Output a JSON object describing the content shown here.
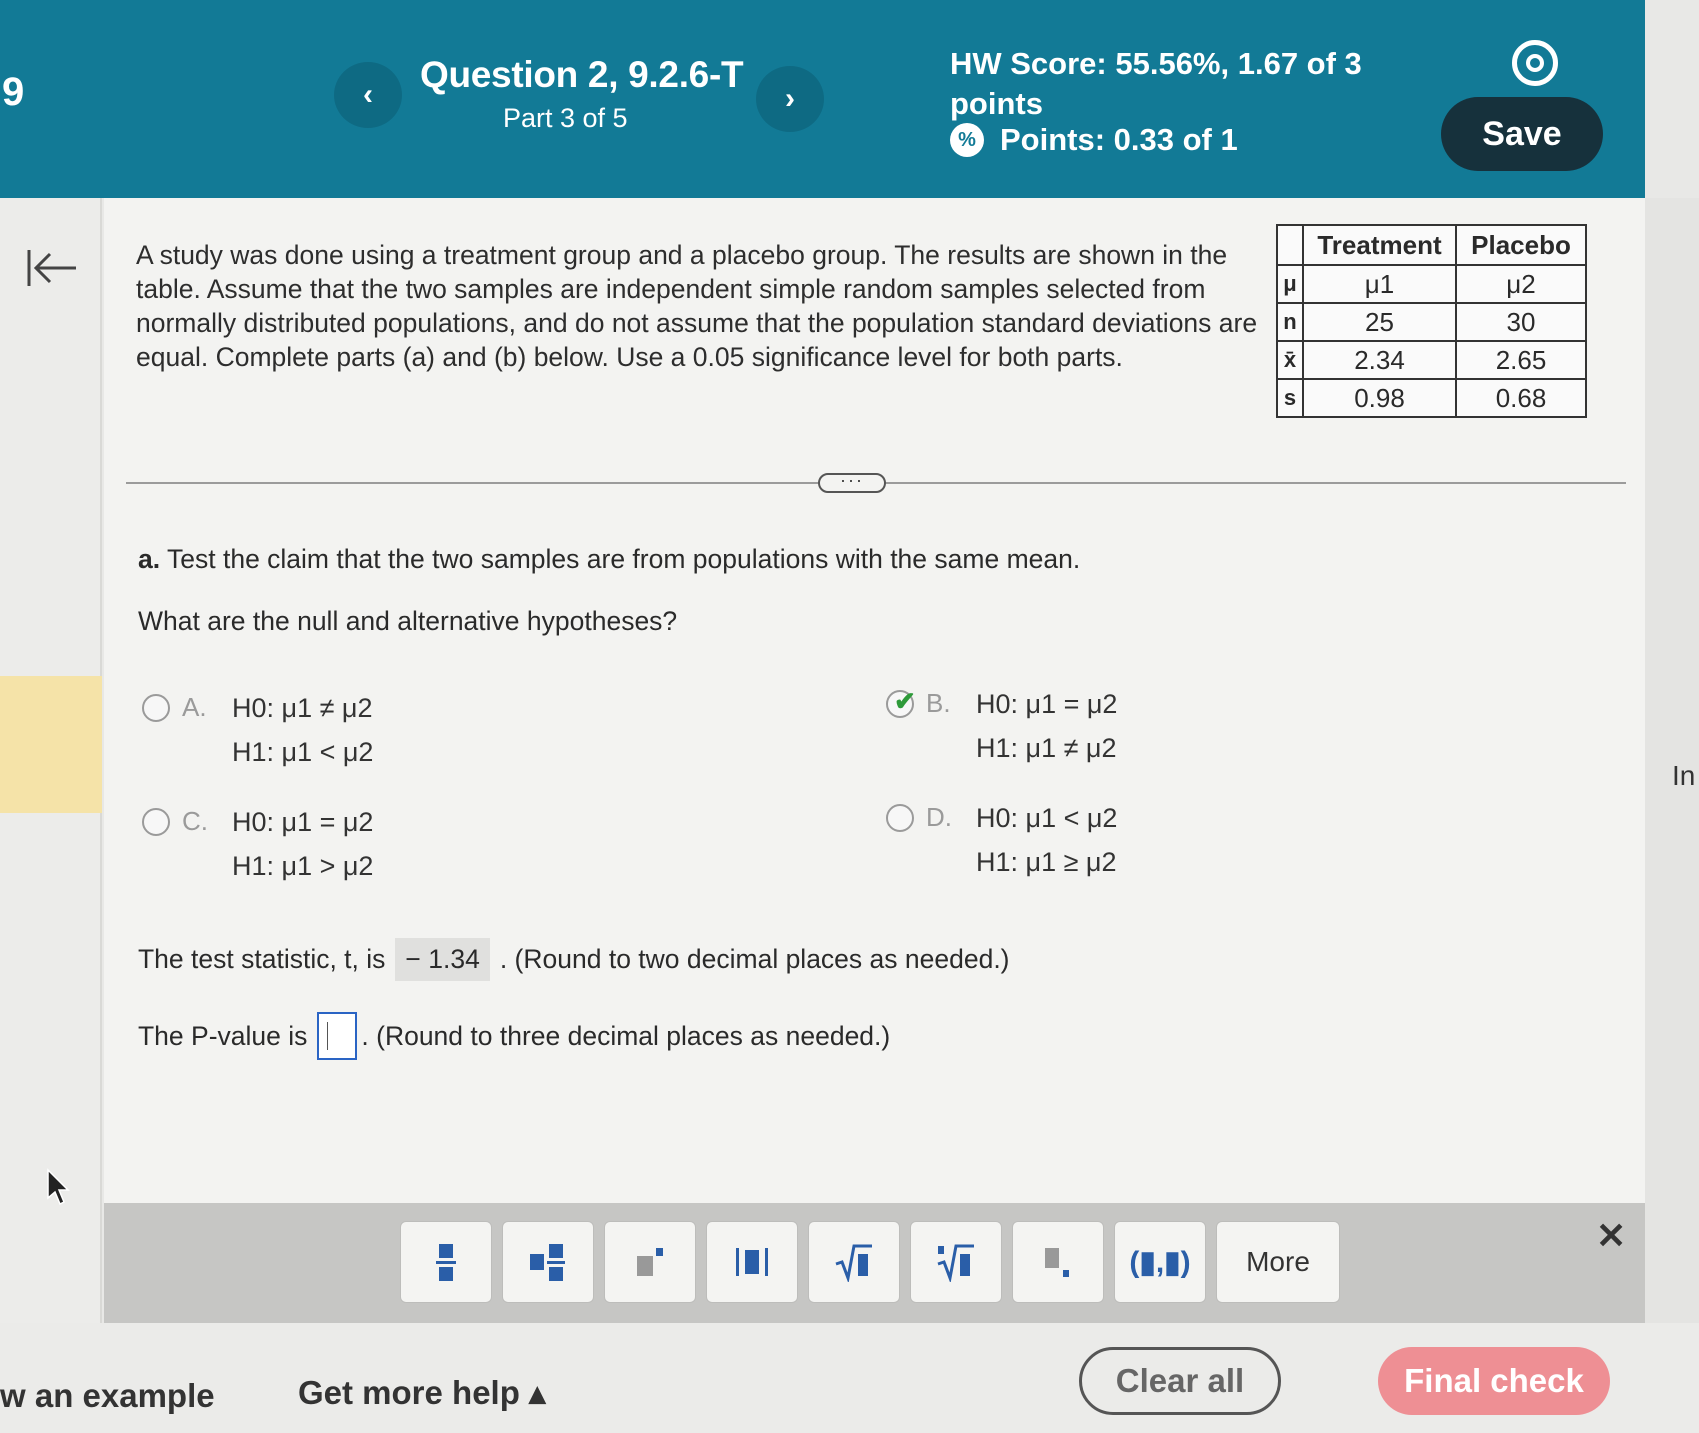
{
  "header": {
    "left_number": "9",
    "question_title": "Question 2, 9.2.6-T",
    "part": "Part 3 of 5",
    "hw_score": "HW Score: 55.56%, 1.67 of 3 points",
    "points": "Points: 0.33 of 1",
    "save_label": "Save"
  },
  "problem": {
    "text": "A study was done using a treatment group and a placebo group. The results are shown in the table. Assume that the two samples are independent simple random samples selected from normally distributed populations, and do not assume that the population standard deviations are equal. Complete parts (a) and (b) below. Use a 0.05 significance level for both parts."
  },
  "table": {
    "headers": [
      "Treatment",
      "Placebo"
    ],
    "rows": [
      {
        "label": "μ",
        "treatment": "μ1",
        "placebo": "μ2"
      },
      {
        "label": "n",
        "treatment": "25",
        "placebo": "30"
      },
      {
        "label": "x̄",
        "treatment": "2.34",
        "placebo": "2.65"
      },
      {
        "label": "s",
        "treatment": "0.98",
        "placebo": "0.68"
      }
    ]
  },
  "part_a": {
    "prompt_bold": "a.",
    "prompt": "Test the claim that the two samples are from populations with the same mean.",
    "question": "What are the null and alternative hypotheses?",
    "options": [
      {
        "letter": "A.",
        "h0": "H0: μ1 ≠ μ2",
        "h1": "H1: μ1 < μ2",
        "selected": false
      },
      {
        "letter": "B.",
        "h0": "H0: μ1 = μ2",
        "h1": "H1: μ1 ≠ μ2",
        "selected": true
      },
      {
        "letter": "C.",
        "h0": "H0: μ1 = μ2",
        "h1": "H1: μ1 > μ2",
        "selected": false
      },
      {
        "letter": "D.",
        "h0": "H0: μ1 < μ2",
        "h1": "H1: μ1 ≥ μ2",
        "selected": false
      }
    ],
    "stat_prefix": "The test statistic, t, is",
    "stat_value": "− 1.34",
    "stat_suffix": ". (Round to two decimal places as needed.)",
    "pval_prefix": "The P-value is",
    "pval_value": "",
    "pval_suffix": ". (Round to three decimal places as needed.)"
  },
  "toolbar": {
    "more_label": "More"
  },
  "footer": {
    "example_label": "w an example",
    "help_label": "Get more help ▴",
    "clear_label": "Clear all",
    "final_label": "Final check"
  },
  "right_edge_text": "In"
}
